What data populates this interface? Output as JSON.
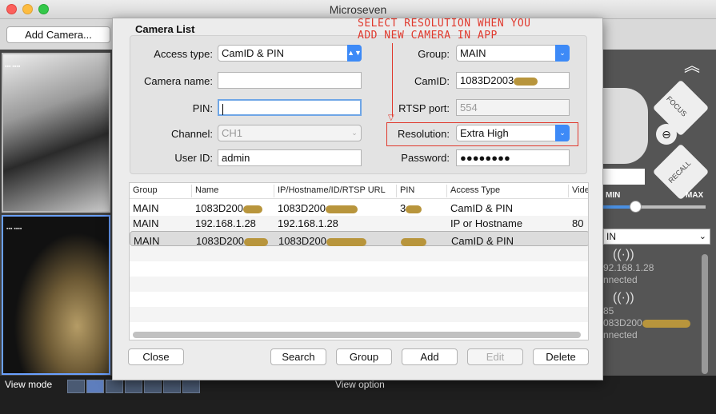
{
  "window": {
    "title": "Microseven"
  },
  "toolbar": {
    "add_camera_label": "Add Camera..."
  },
  "bottom": {
    "view_mode_label": "View mode",
    "view_option_label": "View option"
  },
  "right_panel": {
    "focus_label": "FOCUS",
    "recall_label": "RECALL",
    "min_label": "MIN",
    "max_label": "MAX",
    "group_value": "IN",
    "devices": [
      {
        "line1": "92.168.1.28",
        "line2": "nnected"
      },
      {
        "line1": "85",
        "line2": "083D200",
        "line3": "nnected"
      }
    ]
  },
  "dialog": {
    "title": "Camera List",
    "form": {
      "access_type_label": "Access type:",
      "access_type_value": "CamID & PIN",
      "camera_name_label": "Camera name:",
      "camera_name_value": "",
      "pin_label": "PIN:",
      "pin_value": "",
      "channel_label": "Channel:",
      "channel_value": "CH1",
      "user_id_label": "User ID:",
      "user_id_value": "admin",
      "group_label": "Group:",
      "group_value": "MAIN",
      "camid_label": "CamID:",
      "camid_value": "1083D2003",
      "rtsp_port_label": "RTSP port:",
      "rtsp_port_value": "554",
      "resolution_label": "Resolution:",
      "resolution_value": "Extra High",
      "password_label": "Password:",
      "password_value": "●●●●●●●●"
    },
    "annotation": {
      "line1": "SELECT RESOLUTION WHEN YOU",
      "line2": "ADD NEW CAMERA IN APP"
    },
    "table": {
      "columns": [
        "Group",
        "Name",
        "IP/Hostname/ID/RTSP URL",
        "PIN",
        "Access Type",
        "Vide"
      ],
      "rows": [
        [
          "MAIN",
          "1083D200",
          "1083D200",
          "3",
          "CamID & PIN",
          ""
        ],
        [
          "MAIN",
          "192.168.1.28",
          "192.168.1.28",
          "",
          "IP or Hostname",
          "80"
        ],
        [
          "MAIN",
          "1083D200",
          "1083D200",
          "",
          "CamID & PIN",
          ""
        ]
      ]
    },
    "buttons": {
      "close": "Close",
      "search": "Search",
      "group": "Group",
      "add": "Add",
      "edit": "Edit",
      "delete": "Delete"
    }
  },
  "colors": {
    "accent": "#3d8af7",
    "annotation": "#e0382c"
  }
}
